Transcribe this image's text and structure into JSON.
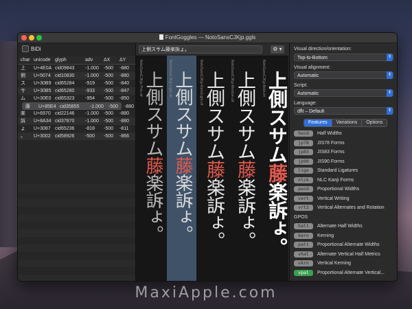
{
  "window": {
    "title": "FontGoggles — NotoSansCJKjp.ggls"
  },
  "left_panel": {
    "bidi_label": "BiDi",
    "columns": [
      "char",
      "unicode",
      "glyph",
      "adv",
      "ΔX",
      "ΔY"
    ],
    "rows": [
      [
        "上",
        "U+4E0A",
        "cid09843",
        "-1.000",
        "-500",
        "-880"
      ],
      [
        "側",
        "U+5074",
        "cid10830",
        "-1.000",
        "-500",
        "-880"
      ],
      [
        "ス",
        "U+30B9",
        "cid65284",
        "-919",
        "-500",
        "-840"
      ],
      [
        "サ",
        "U+30B5",
        "cid65280",
        "-933",
        "-500",
        "-847"
      ],
      [
        "ム",
        "U+30E0",
        "cid65323",
        "-954",
        "-500",
        "-850"
      ],
      [
        "藤",
        "U+85E4",
        "cid35855",
        "-1.000",
        "-500",
        "-880"
      ],
      [
        "楽",
        "U+6970",
        "cid22146",
        "-1.000",
        "-500",
        "-880"
      ],
      [
        "訴",
        "U+8A34",
        "cid37870",
        "-1.000",
        "-500",
        "-880"
      ],
      [
        "ょ",
        "U+3087",
        "cid65236",
        "-818",
        "-500",
        "-811"
      ],
      [
        "。",
        "U+3002",
        "cid58926",
        "-500",
        "-500",
        "-866"
      ]
    ]
  },
  "center": {
    "text_field_value": "上側スサム藤楽訴ょ。",
    "gear_label": "⚙ ▾",
    "columns": [
      {
        "font_label": "NotoSansCJKjp-Thin.otf",
        "text_a": "上側スサム",
        "text_red": "藤",
        "text_b": "楽訴ょ。",
        "weight": "100",
        "color": "#b8b8b8"
      },
      {
        "font_label": "NotoSansCJKjp-Light.otf",
        "text_a": "上側スサム",
        "text_red": "藤",
        "text_b": "楽訴ょ。",
        "weight": "300",
        "color": "#d8d8d8"
      },
      {
        "font_label": "NotoSansCJKjp-DemiLight.otf",
        "text_a": "上側スサム",
        "text_red": "藤",
        "text_b": "楽訴ょ。",
        "weight": "400",
        "color": "#e6e6e6"
      },
      {
        "font_label": "NotoSansCJKjp-Medium.otf",
        "text_a": "上側スサム",
        "text_red": "藤",
        "text_b": "楽訴ょ。",
        "weight": "500",
        "color": "#f0f0f0"
      },
      {
        "font_label": "NotoSansCJKjp-Bold.otf",
        "text_a": "上側スサム",
        "text_red": "藤",
        "text_b": "楽訴ょ。",
        "weight": "700",
        "color": "#ffffff"
      }
    ]
  },
  "right_panel": {
    "direction_label": "Visual direction/orientation:",
    "direction_value": "Top-to-Bottom",
    "alignment_label": "Visual alignment:",
    "alignment_value": "Automatic",
    "script_label": "Script:",
    "script_value": "Automatic",
    "language_label": "Language:",
    "language_value": "dflt – Default",
    "tabs": [
      "Features",
      "Variations",
      "Options"
    ],
    "gsub_features": [
      {
        "tag": "hwid",
        "desc": "Half Widths",
        "on": false
      },
      {
        "tag": "jp78",
        "desc": "JIS78 Forms",
        "on": false
      },
      {
        "tag": "jp83",
        "desc": "JIS83 Forms",
        "on": false
      },
      {
        "tag": "jp90",
        "desc": "JIS90 Forms",
        "on": false
      },
      {
        "tag": "liga",
        "desc": "Standard Ligatures",
        "on": false
      },
      {
        "tag": "nlck",
        "desc": "NLC Kanji Forms",
        "on": false
      },
      {
        "tag": "pwid",
        "desc": "Proportional Widths",
        "on": false
      },
      {
        "tag": "vert",
        "desc": "Vertical Writing",
        "on": false
      },
      {
        "tag": "vrt2",
        "desc": "Vertical Alternates and Rotation",
        "on": false
      }
    ],
    "gpos_label": "GPOS",
    "gpos_features": [
      {
        "tag": "halt",
        "desc": "Alternate Half Widths",
        "on": false
      },
      {
        "tag": "kern",
        "desc": "Kerning",
        "on": false
      },
      {
        "tag": "palt",
        "desc": "Proportional Alternate Widths",
        "on": false
      },
      {
        "tag": "vhal",
        "desc": "Alternate Vertical Half Metrics",
        "on": false
      },
      {
        "tag": "vkrn",
        "desc": "Vertical Kerning",
        "on": false
      },
      {
        "tag": "vpal",
        "desc": "Proportional Alternate Vertical...",
        "on": true
      }
    ]
  },
  "colors": {
    "accent": "#2f6fd8",
    "highlight_column": "#3f5268",
    "kanji_red": "#e05a4e",
    "feature_on": "#3aa050"
  },
  "watermark": "MaxiApple.com"
}
